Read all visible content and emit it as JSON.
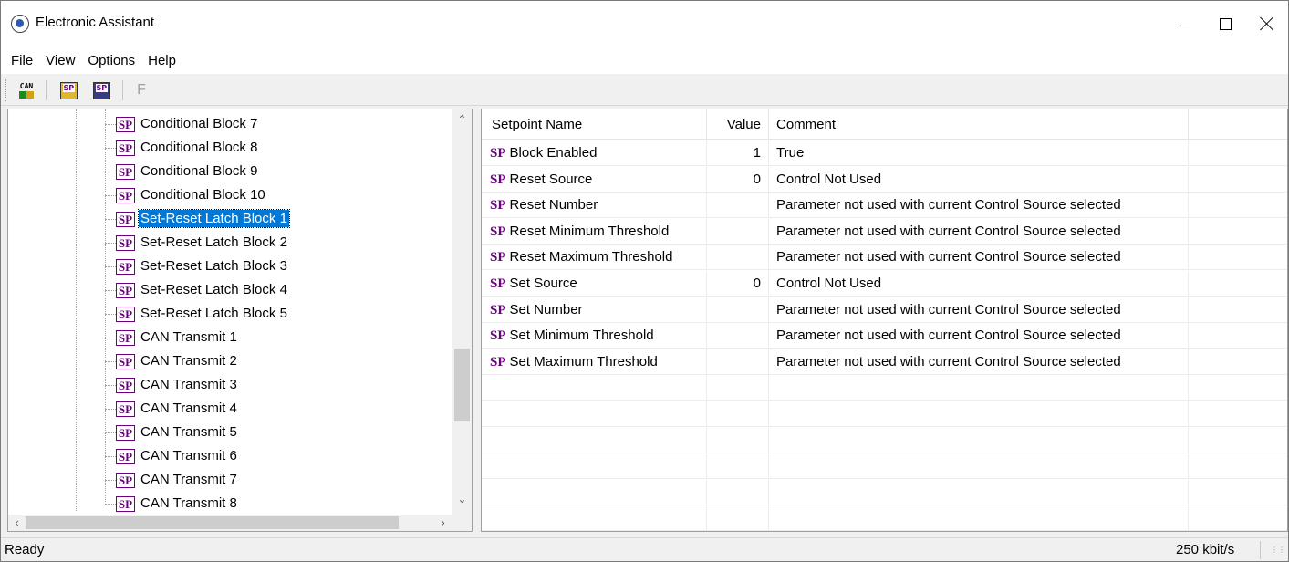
{
  "window": {
    "title": "Electronic Assistant"
  },
  "menu": [
    "File",
    "View",
    "Options",
    "Help"
  ],
  "toolbar": {
    "can_icon_text": "CAN",
    "open_icon_text": "SP",
    "save_icon_text": "SP",
    "f_label": "F"
  },
  "tree": {
    "icon_text": "SP",
    "items": [
      {
        "label": "Conditional Block 7",
        "selected": false
      },
      {
        "label": "Conditional Block 8",
        "selected": false
      },
      {
        "label": "Conditional Block 9",
        "selected": false
      },
      {
        "label": "Conditional Block 10",
        "selected": false
      },
      {
        "label": "Set-Reset Latch Block 1",
        "selected": true
      },
      {
        "label": "Set-Reset Latch Block 2",
        "selected": false
      },
      {
        "label": "Set-Reset Latch Block 3",
        "selected": false
      },
      {
        "label": "Set-Reset Latch Block 4",
        "selected": false
      },
      {
        "label": "Set-Reset Latch Block 5",
        "selected": false
      },
      {
        "label": "CAN Transmit 1",
        "selected": false
      },
      {
        "label": "CAN Transmit 2",
        "selected": false
      },
      {
        "label": "CAN Transmit 3",
        "selected": false
      },
      {
        "label": "CAN Transmit 4",
        "selected": false
      },
      {
        "label": "CAN Transmit 5",
        "selected": false
      },
      {
        "label": "CAN Transmit 6",
        "selected": false
      },
      {
        "label": "CAN Transmit 7",
        "selected": false
      },
      {
        "label": "CAN Transmit 8",
        "selected": false
      }
    ]
  },
  "grid": {
    "columns": [
      "Setpoint Name",
      "Value",
      "Comment"
    ],
    "sp_prefix": "SP",
    "rows": [
      {
        "name": "Block Enabled",
        "value": "1",
        "comment": "True"
      },
      {
        "name": "Reset Source",
        "value": "0",
        "comment": "Control Not Used"
      },
      {
        "name": "Reset Number",
        "value": "",
        "comment": "Parameter not used with current Control Source selected"
      },
      {
        "name": "Reset Minimum Threshold",
        "value": "",
        "comment": "Parameter not used with current Control Source selected"
      },
      {
        "name": "Reset Maximum Threshold",
        "value": "",
        "comment": "Parameter not used with current Control Source selected"
      },
      {
        "name": "Set Source",
        "value": "0",
        "comment": "Control Not Used"
      },
      {
        "name": "Set Number",
        "value": "",
        "comment": "Parameter not used with current Control Source selected"
      },
      {
        "name": "Set Minimum Threshold",
        "value": "",
        "comment": "Parameter not used with current Control Source selected"
      },
      {
        "name": "Set Maximum Threshold",
        "value": "",
        "comment": "Parameter not used with current Control Source selected"
      }
    ],
    "empty_rows": 7
  },
  "status": {
    "left": "Ready",
    "right": "250 kbit/s"
  }
}
